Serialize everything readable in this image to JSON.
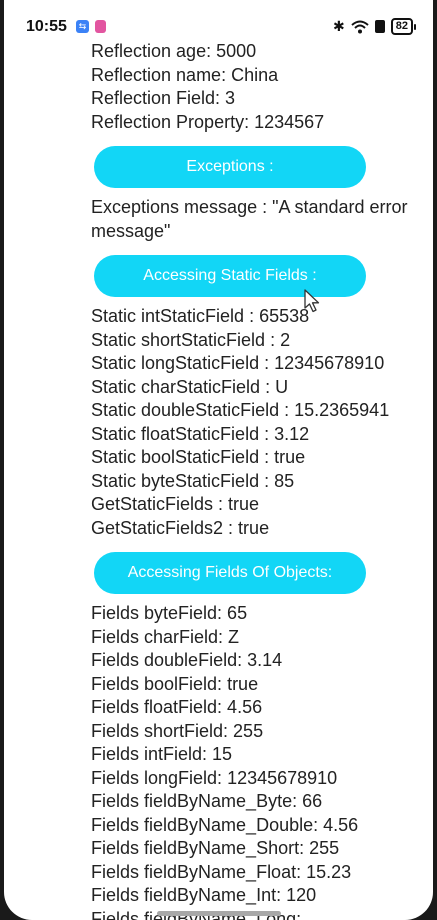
{
  "status_bar": {
    "time": "10:55",
    "battery": "82"
  },
  "reflection_lines": [
    "Reflection age: 5000",
    "Reflection name: China",
    "Reflection Field: 3",
    "Reflection Property: 1234567"
  ],
  "exceptions": {
    "button_label": "Exceptions :",
    "message": "Exceptions message : \"A standard error message\""
  },
  "static_fields": {
    "button_label": "Accessing Static Fields :",
    "lines": [
      "Static intStaticField : 65538",
      "Static shortStaticField : 2",
      "Static longStaticField : 12345678910",
      "Static charStaticField : U",
      "Static doubleStaticField : 15.2365941",
      "Static floatStaticField : 3.12",
      "Static boolStaticField : true",
      "Static byteStaticField : 85",
      "GetStaticFields : true",
      "GetStaticFields2 : true"
    ]
  },
  "object_fields": {
    "button_label": "Accessing Fields Of Objects:",
    "lines": [
      "Fields byteField: 65",
      "Fields charField: Z",
      "Fields doubleField: 3.14",
      "Fields boolField: true",
      "Fields floatField: 4.56",
      "Fields shortField: 255",
      "Fields intField: 15",
      "Fields longField: 12345678910",
      "Fields fieldByName_Byte: 66",
      "Fields fieldByName_Double: 4.56",
      "Fields fieldByName_Short: 255",
      "Fields fieldByName_Float: 15.23",
      "Fields fieldByName_Int: 120",
      "Fields fieldByName_Long:"
    ]
  }
}
